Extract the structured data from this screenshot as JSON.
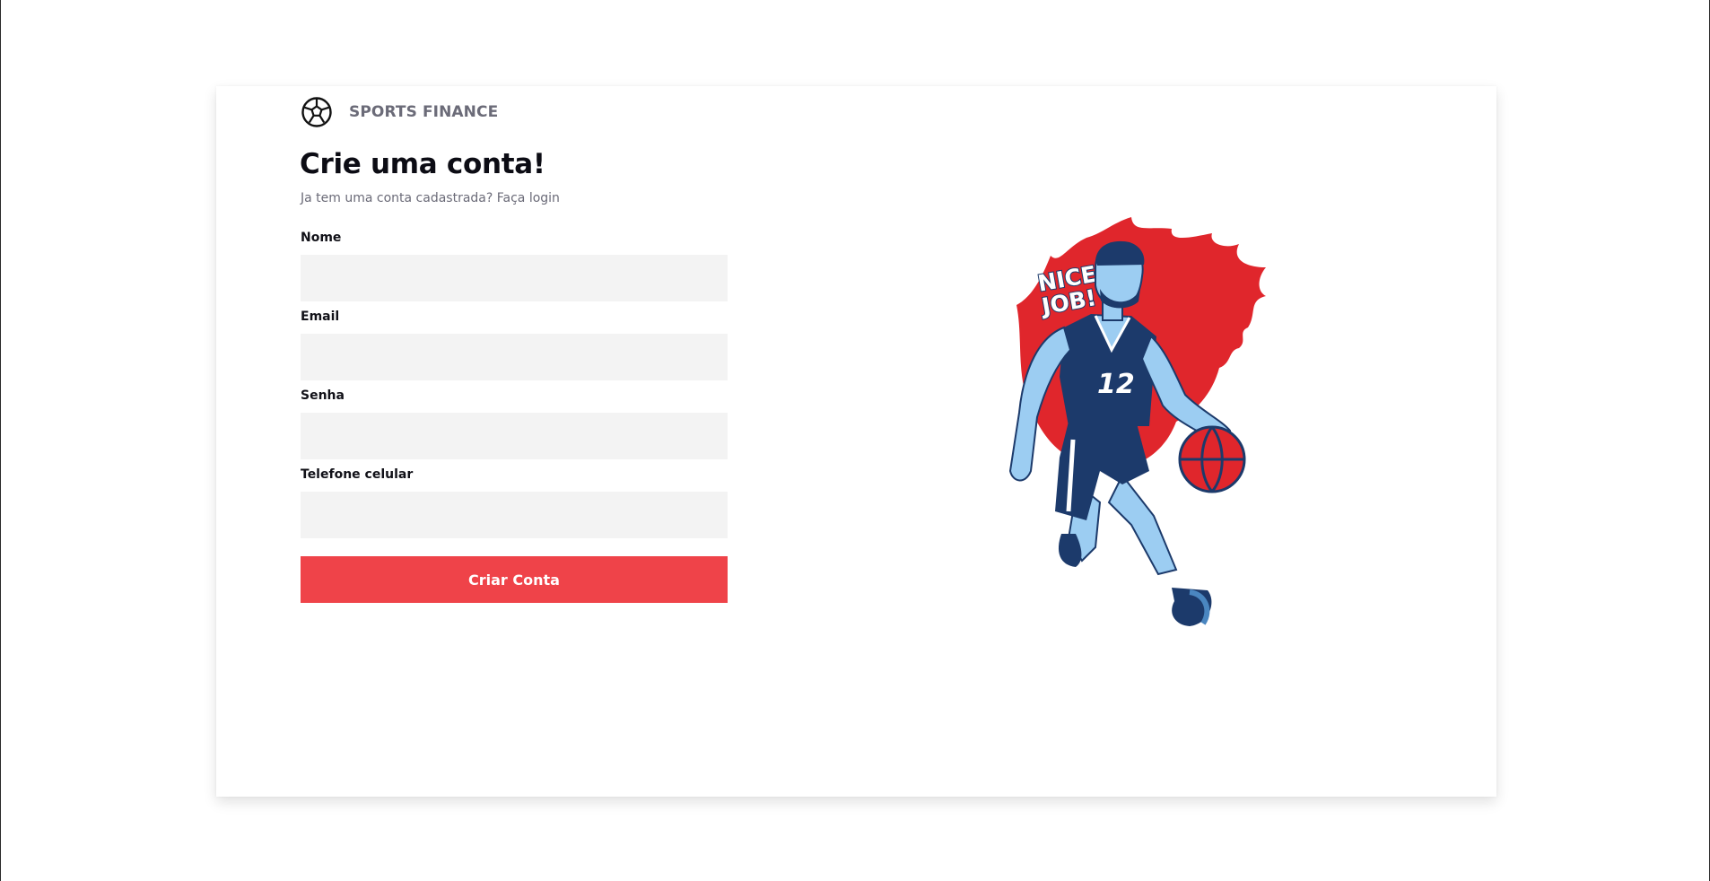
{
  "brand": {
    "name": "SPORTS FINANCE",
    "icon": "soccer-ball-icon"
  },
  "form": {
    "title": "Crie uma conta!",
    "subtitle_prefix": "Ja tem uma conta cadastrada? ",
    "login_link": "Faça login",
    "fields": [
      {
        "label": "Nome",
        "value": "",
        "placeholder": ""
      },
      {
        "label": "Email",
        "value": "",
        "placeholder": ""
      },
      {
        "label": "Senha",
        "value": "",
        "placeholder": ""
      },
      {
        "label": "Telefone celular",
        "value": "",
        "placeholder": ""
      }
    ],
    "submit_label": "Criar Conta"
  },
  "illustration": {
    "caption": "NICE JOB!",
    "caption_line1": "NICE",
    "caption_line2": "JOB!",
    "jersey_number": "12"
  },
  "colors": {
    "accent": "#ef4349",
    "flame": "#e0262c",
    "jersey": "#1c3a6b",
    "skin": "#9ccdf2",
    "input_bg": "#f3f3f3",
    "muted_text": "#6b6b78"
  }
}
